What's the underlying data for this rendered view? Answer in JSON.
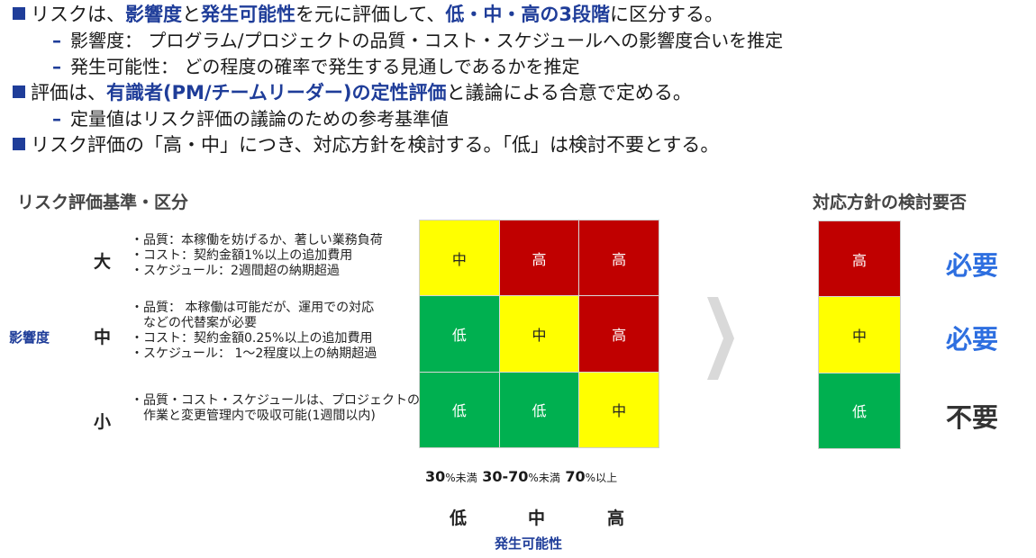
{
  "bullets": [
    {
      "level": 1,
      "parts": [
        {
          "t": "リスクは、"
        },
        {
          "t": "影響度",
          "blue": true
        },
        {
          "t": "と"
        },
        {
          "t": "発生可能性",
          "blue": true
        },
        {
          "t": "を元に評価して、"
        },
        {
          "t": "低・中・高の3段階",
          "blue": true
        },
        {
          "t": "に区分する。"
        }
      ]
    },
    {
      "level": 2,
      "parts": [
        {
          "t": "影響度： プログラム/プロジェクトの品質・コスト・スケジュールへの影響度合いを推定"
        }
      ]
    },
    {
      "level": 2,
      "parts": [
        {
          "t": "発生可能性： どの程度の確率で発生する見通しであるかを推定"
        }
      ]
    },
    {
      "level": 1,
      "parts": [
        {
          "t": "評価は、"
        },
        {
          "t": "有識者(PM/チームリーダー)の定性評価",
          "blue": true
        },
        {
          "t": "と議論による合意で定める。"
        }
      ]
    },
    {
      "level": 2,
      "parts": [
        {
          "t": "定量値はリスク評価の議論のための参考基準値"
        }
      ]
    },
    {
      "level": 1,
      "parts": [
        {
          "t": "リスク評価の「高・中」につき、対応方針を検討する。「低」は検討不要とする。"
        }
      ]
    }
  ],
  "dash": "–",
  "criteria_title": "リスク評価基準・区分",
  "policy_title": "対応方針の検討要否",
  "impact_axis_label": "影響度",
  "impact_levels": [
    {
      "label": "大",
      "desc": [
        "・品質：本稼働を妨げるか、著しい業務負荷",
        "・コスト：契約金額1%以上の追加費用",
        "・スケジュール：2週間超の納期超過"
      ]
    },
    {
      "label": "中",
      "desc": [
        "・品質： 本稼働は可能だが、運用での対応",
        "　などの代替案が必要",
        "・コスト：契約金額0.25%以上の追加費用",
        "・スケジュール： 1～2程度以上の納期超過"
      ]
    },
    {
      "label": "小",
      "desc": [
        "・品質・コスト・スケジュールは、プロジェクトの",
        "　作業と変更管理内で吸収可能(1週間以内)"
      ]
    }
  ],
  "matrix": [
    [
      {
        "v": "中",
        "k": "mid"
      },
      {
        "v": "高",
        "k": "hi"
      },
      {
        "v": "高",
        "k": "hi"
      }
    ],
    [
      {
        "v": "低",
        "k": "lo"
      },
      {
        "v": "中",
        "k": "mid"
      },
      {
        "v": "高",
        "k": "hi"
      }
    ],
    [
      {
        "v": "低",
        "k": "lo"
      },
      {
        "v": "低",
        "k": "lo"
      },
      {
        "v": "中",
        "k": "mid"
      }
    ]
  ],
  "prob_thresholds": [
    {
      "num": "30",
      "unit": "%未満"
    },
    {
      "num": "30-70",
      "unit": "%未満"
    },
    {
      "num": "70",
      "unit": "%以上"
    }
  ],
  "prob_levels": [
    "低",
    "中",
    "高"
  ],
  "prob_axis_label": "発生可能性",
  "policy": [
    {
      "level": "高",
      "k": "hi",
      "need": "必要",
      "yes": true
    },
    {
      "level": "中",
      "k": "mid",
      "need": "必要",
      "yes": true
    },
    {
      "level": "低",
      "k": "lo",
      "need": "不要",
      "yes": false
    }
  ],
  "colors": {
    "hi": "#c00000",
    "mid": "#ffff00",
    "lo": "#00b050",
    "accent": "#1f3d99",
    "need": "#2e6fe0"
  },
  "icons": {
    "bullet": "square-bullet-icon",
    "arrow": "chevron-right-arrow-icon"
  }
}
